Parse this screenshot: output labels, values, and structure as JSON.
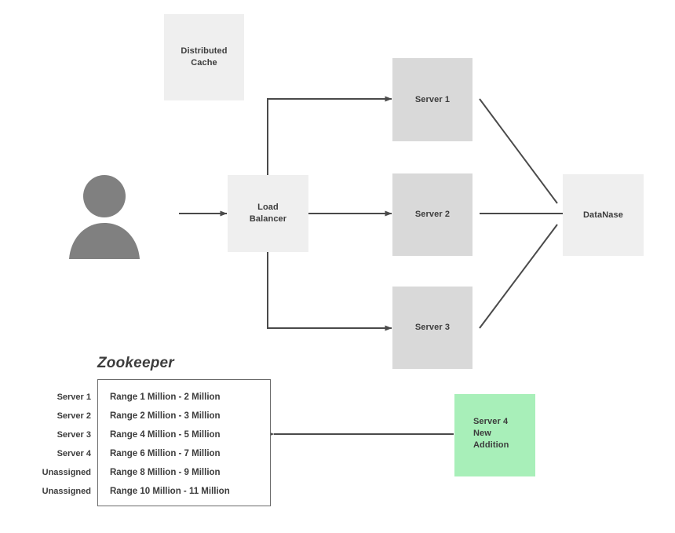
{
  "diagram": {
    "title_text": "Zookeeper",
    "colors": {
      "light_gray": "#efefef",
      "mid_gray": "#d9d9d9",
      "green": "#a8efb9",
      "line": "#4a4a4a",
      "text": "#3c3c3c",
      "avatar": "#808080"
    },
    "nodes": {
      "distributed_cache": "Distributed\nCache",
      "distributed_cache_line1": "Distributed",
      "distributed_cache_line2": "Cache",
      "load_balancer_line1": "Load",
      "load_balancer_line2": "Balancer",
      "server1": "Server 1",
      "server2": "Server 2",
      "server3": "Server 3",
      "database": "DataNase",
      "new_server_line1": "Server 4",
      "new_server_line2": "New",
      "new_server_line3": "Addition"
    },
    "avatar": {
      "name": "user-avatar"
    },
    "zookeeper": {
      "heading": "Zookeeper",
      "assignments": [
        {
          "owner": "Server 1",
          "range": "Range 1 Million - 2 Million"
        },
        {
          "owner": "Server 2",
          "range": "Range 2 Million - 3 Million"
        },
        {
          "owner": "Server 3",
          "range": "Range 4 Million - 5 Million"
        },
        {
          "owner": "Server 4",
          "range": "Range 6 Million - 7 Million"
        },
        {
          "owner": "Unassigned",
          "range": "Range 8 Million - 9 Million"
        },
        {
          "owner": "Unassigned",
          "range": "Range 10 Million - 11 Million"
        }
      ]
    },
    "connectors": [
      {
        "name": "user-to-load-balancer",
        "kind": "arrow"
      },
      {
        "name": "load-balancer-to-server-1",
        "kind": "elbow-arrow"
      },
      {
        "name": "load-balancer-to-server-2",
        "kind": "arrow"
      },
      {
        "name": "load-balancer-to-server-3",
        "kind": "elbow-arrow"
      },
      {
        "name": "server-1-to-database",
        "kind": "line"
      },
      {
        "name": "server-2-to-database",
        "kind": "line"
      },
      {
        "name": "server-3-to-database",
        "kind": "line"
      },
      {
        "name": "new-server-to-zookeeper",
        "kind": "arrow"
      }
    ]
  }
}
